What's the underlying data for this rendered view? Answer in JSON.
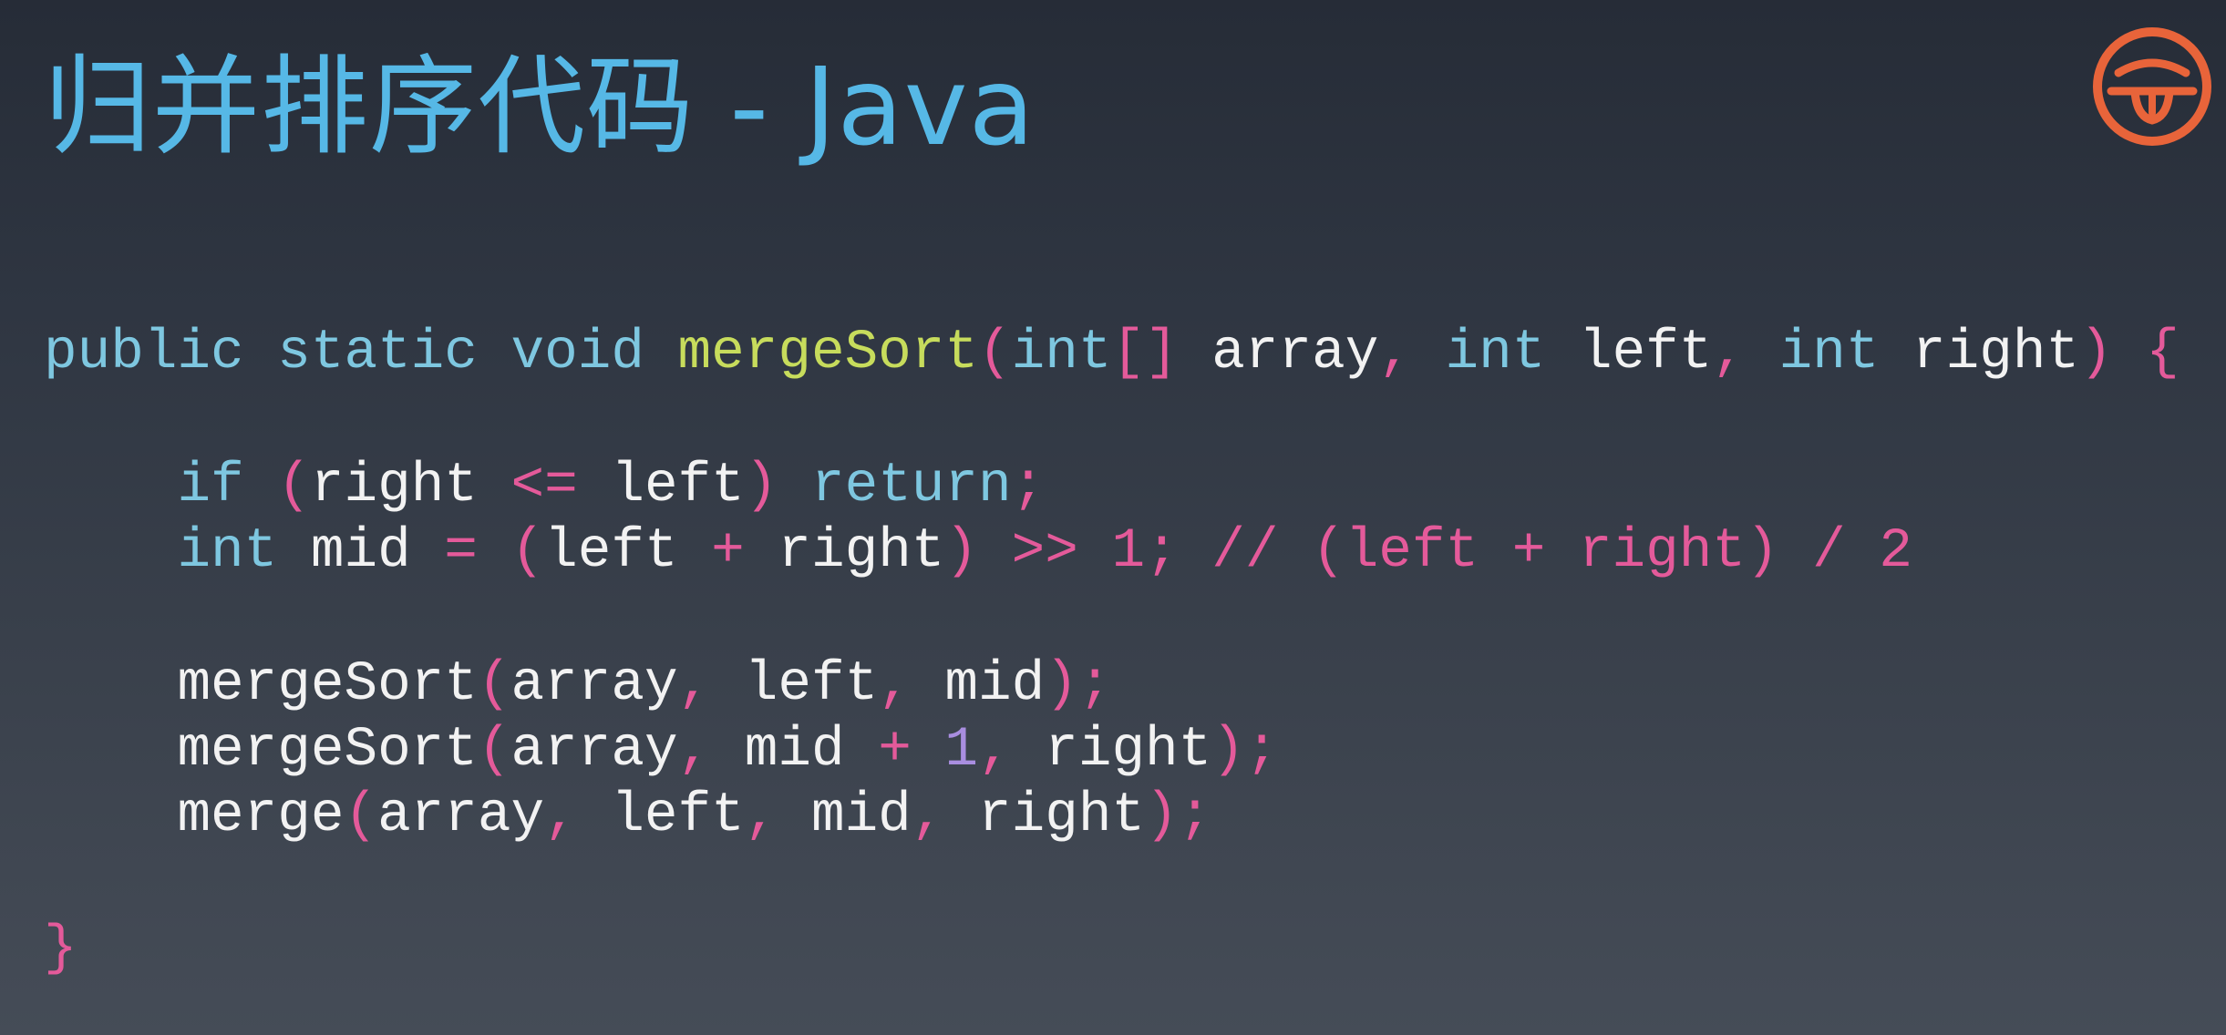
{
  "slide": {
    "title": "归并排序代码 - Java",
    "logo_icon": "geekbang-logo-icon",
    "accent_color": "#56b8e6",
    "logo_color": "#e8643a"
  },
  "code": {
    "language": "Java",
    "lines": [
      [
        {
          "t": "public",
          "c": "kw"
        },
        {
          "t": " ",
          "c": "id"
        },
        {
          "t": "static",
          "c": "kw"
        },
        {
          "t": " ",
          "c": "id"
        },
        {
          "t": "void",
          "c": "kw"
        },
        {
          "t": " ",
          "c": "id"
        },
        {
          "t": "mergeSort",
          "c": "fn"
        },
        {
          "t": "(",
          "c": "pn"
        },
        {
          "t": "int",
          "c": "ty"
        },
        {
          "t": "[]",
          "c": "pn"
        },
        {
          "t": " array",
          "c": "id"
        },
        {
          "t": ",",
          "c": "pn"
        },
        {
          "t": " ",
          "c": "id"
        },
        {
          "t": "int",
          "c": "ty"
        },
        {
          "t": " left",
          "c": "id"
        },
        {
          "t": ",",
          "c": "pn"
        },
        {
          "t": " ",
          "c": "id"
        },
        {
          "t": "int",
          "c": "ty"
        },
        {
          "t": " right",
          "c": "id"
        },
        {
          "t": ")",
          "c": "pn"
        },
        {
          "t": " ",
          "c": "id"
        },
        {
          "t": "{",
          "c": "pn"
        }
      ],
      [],
      [
        {
          "t": "    ",
          "c": "id"
        },
        {
          "t": "if",
          "c": "kw"
        },
        {
          "t": " ",
          "c": "id"
        },
        {
          "t": "(",
          "c": "pn"
        },
        {
          "t": "right",
          "c": "id"
        },
        {
          "t": " ",
          "c": "id"
        },
        {
          "t": "<=",
          "c": "op"
        },
        {
          "t": " left",
          "c": "id"
        },
        {
          "t": ")",
          "c": "pn"
        },
        {
          "t": " ",
          "c": "id"
        },
        {
          "t": "return",
          "c": "kw"
        },
        {
          "t": ";",
          "c": "pn"
        }
      ],
      [
        {
          "t": "    ",
          "c": "id"
        },
        {
          "t": "int",
          "c": "ty"
        },
        {
          "t": " mid ",
          "c": "id"
        },
        {
          "t": "=",
          "c": "op"
        },
        {
          "t": " ",
          "c": "id"
        },
        {
          "t": "(",
          "c": "pn"
        },
        {
          "t": "left ",
          "c": "id"
        },
        {
          "t": "+",
          "c": "op"
        },
        {
          "t": " right",
          "c": "id"
        },
        {
          "t": ")",
          "c": "pn"
        },
        {
          "t": " ",
          "c": "id"
        },
        {
          "t": ">>",
          "c": "op"
        },
        {
          "t": " ",
          "c": "id"
        },
        {
          "t": "1",
          "c": "nm"
        },
        {
          "t": ";",
          "c": "pn"
        },
        {
          "t": " // (left + right) / 2",
          "c": "cm"
        }
      ],
      [],
      [
        {
          "t": "    ",
          "c": "id"
        },
        {
          "t": "mergeSort",
          "c": "id"
        },
        {
          "t": "(",
          "c": "pn"
        },
        {
          "t": "array",
          "c": "id"
        },
        {
          "t": ",",
          "c": "pn"
        },
        {
          "t": " left",
          "c": "id"
        },
        {
          "t": ",",
          "c": "pn"
        },
        {
          "t": " mid",
          "c": "id"
        },
        {
          "t": ");",
          "c": "pn"
        }
      ],
      [
        {
          "t": "    ",
          "c": "id"
        },
        {
          "t": "mergeSort",
          "c": "id"
        },
        {
          "t": "(",
          "c": "pn"
        },
        {
          "t": "array",
          "c": "id"
        },
        {
          "t": ",",
          "c": "pn"
        },
        {
          "t": " mid ",
          "c": "id"
        },
        {
          "t": "+",
          "c": "op"
        },
        {
          "t": " ",
          "c": "id"
        },
        {
          "t": "1",
          "c": "nm2"
        },
        {
          "t": ",",
          "c": "pn"
        },
        {
          "t": " right",
          "c": "id"
        },
        {
          "t": ");",
          "c": "pn"
        }
      ],
      [
        {
          "t": "    ",
          "c": "id"
        },
        {
          "t": "merge",
          "c": "id"
        },
        {
          "t": "(",
          "c": "pn"
        },
        {
          "t": "array",
          "c": "id"
        },
        {
          "t": ",",
          "c": "pn"
        },
        {
          "t": " left",
          "c": "id"
        },
        {
          "t": ",",
          "c": "pn"
        },
        {
          "t": " mid",
          "c": "id"
        },
        {
          "t": ",",
          "c": "pn"
        },
        {
          "t": " right",
          "c": "id"
        },
        {
          "t": ");",
          "c": "pn"
        }
      ],
      [],
      [
        {
          "t": "}",
          "c": "pn"
        }
      ]
    ]
  }
}
